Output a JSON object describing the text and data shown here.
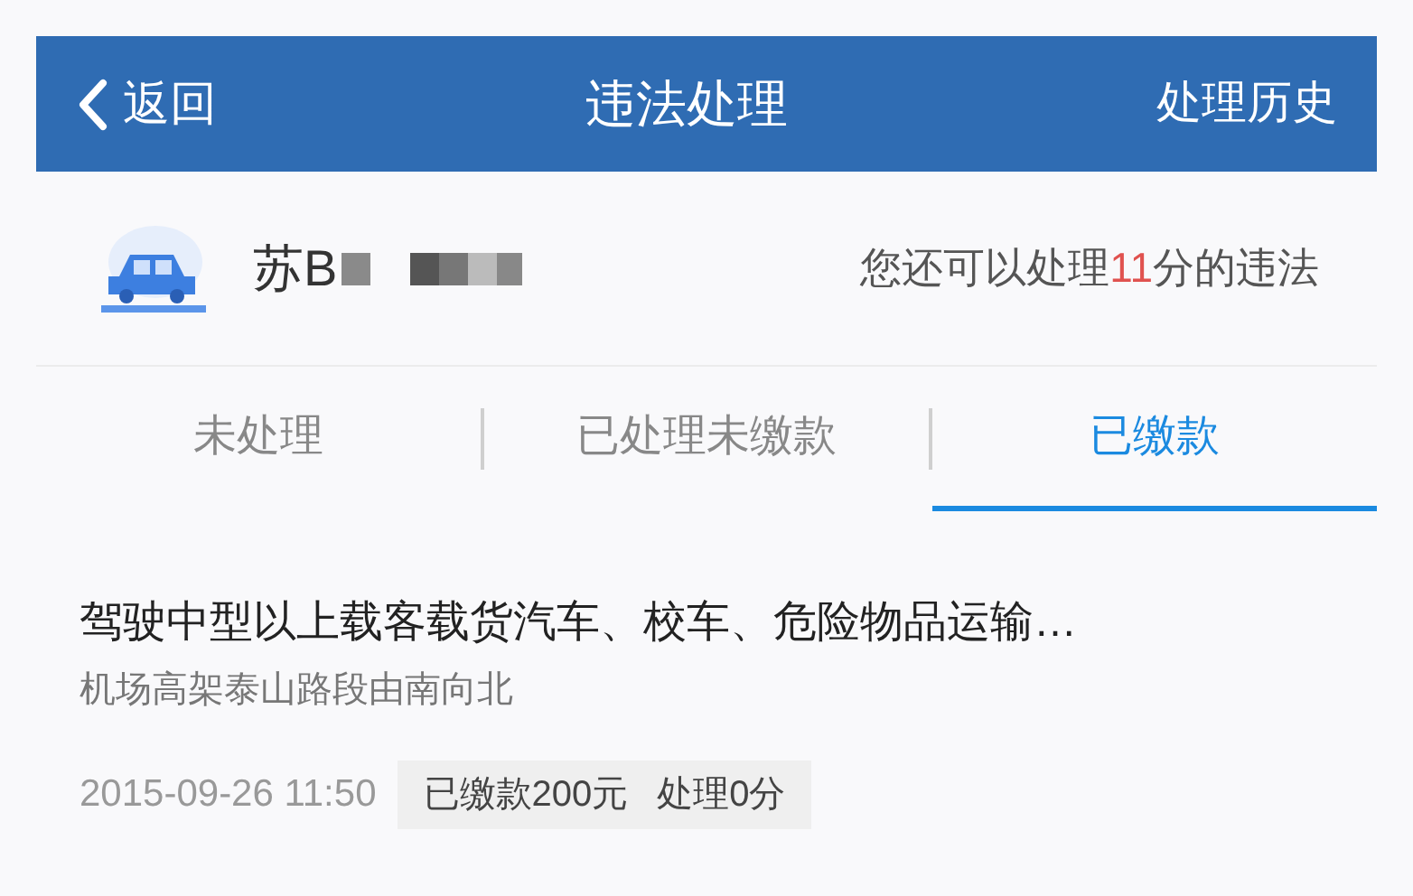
{
  "header": {
    "back": "返回",
    "title": "违法处理",
    "action": "处理历史"
  },
  "vehicle": {
    "plate": "苏B",
    "points_prefix": "您还可以处理",
    "points": "11",
    "points_suffix": "分的违法"
  },
  "tabs": [
    {
      "label": "未处理",
      "selected": false
    },
    {
      "label": "已处理未缴款",
      "selected": false
    },
    {
      "label": "已缴款",
      "selected": true
    }
  ],
  "violations": [
    {
      "title": "驾驶中型以上载客载货汽车、校车、危险物品运输…",
      "location": "机场高架泰山路段由南向北",
      "time": "2015-09-26 11:50",
      "fine": "已缴款200元",
      "points": "处理0分"
    }
  ]
}
